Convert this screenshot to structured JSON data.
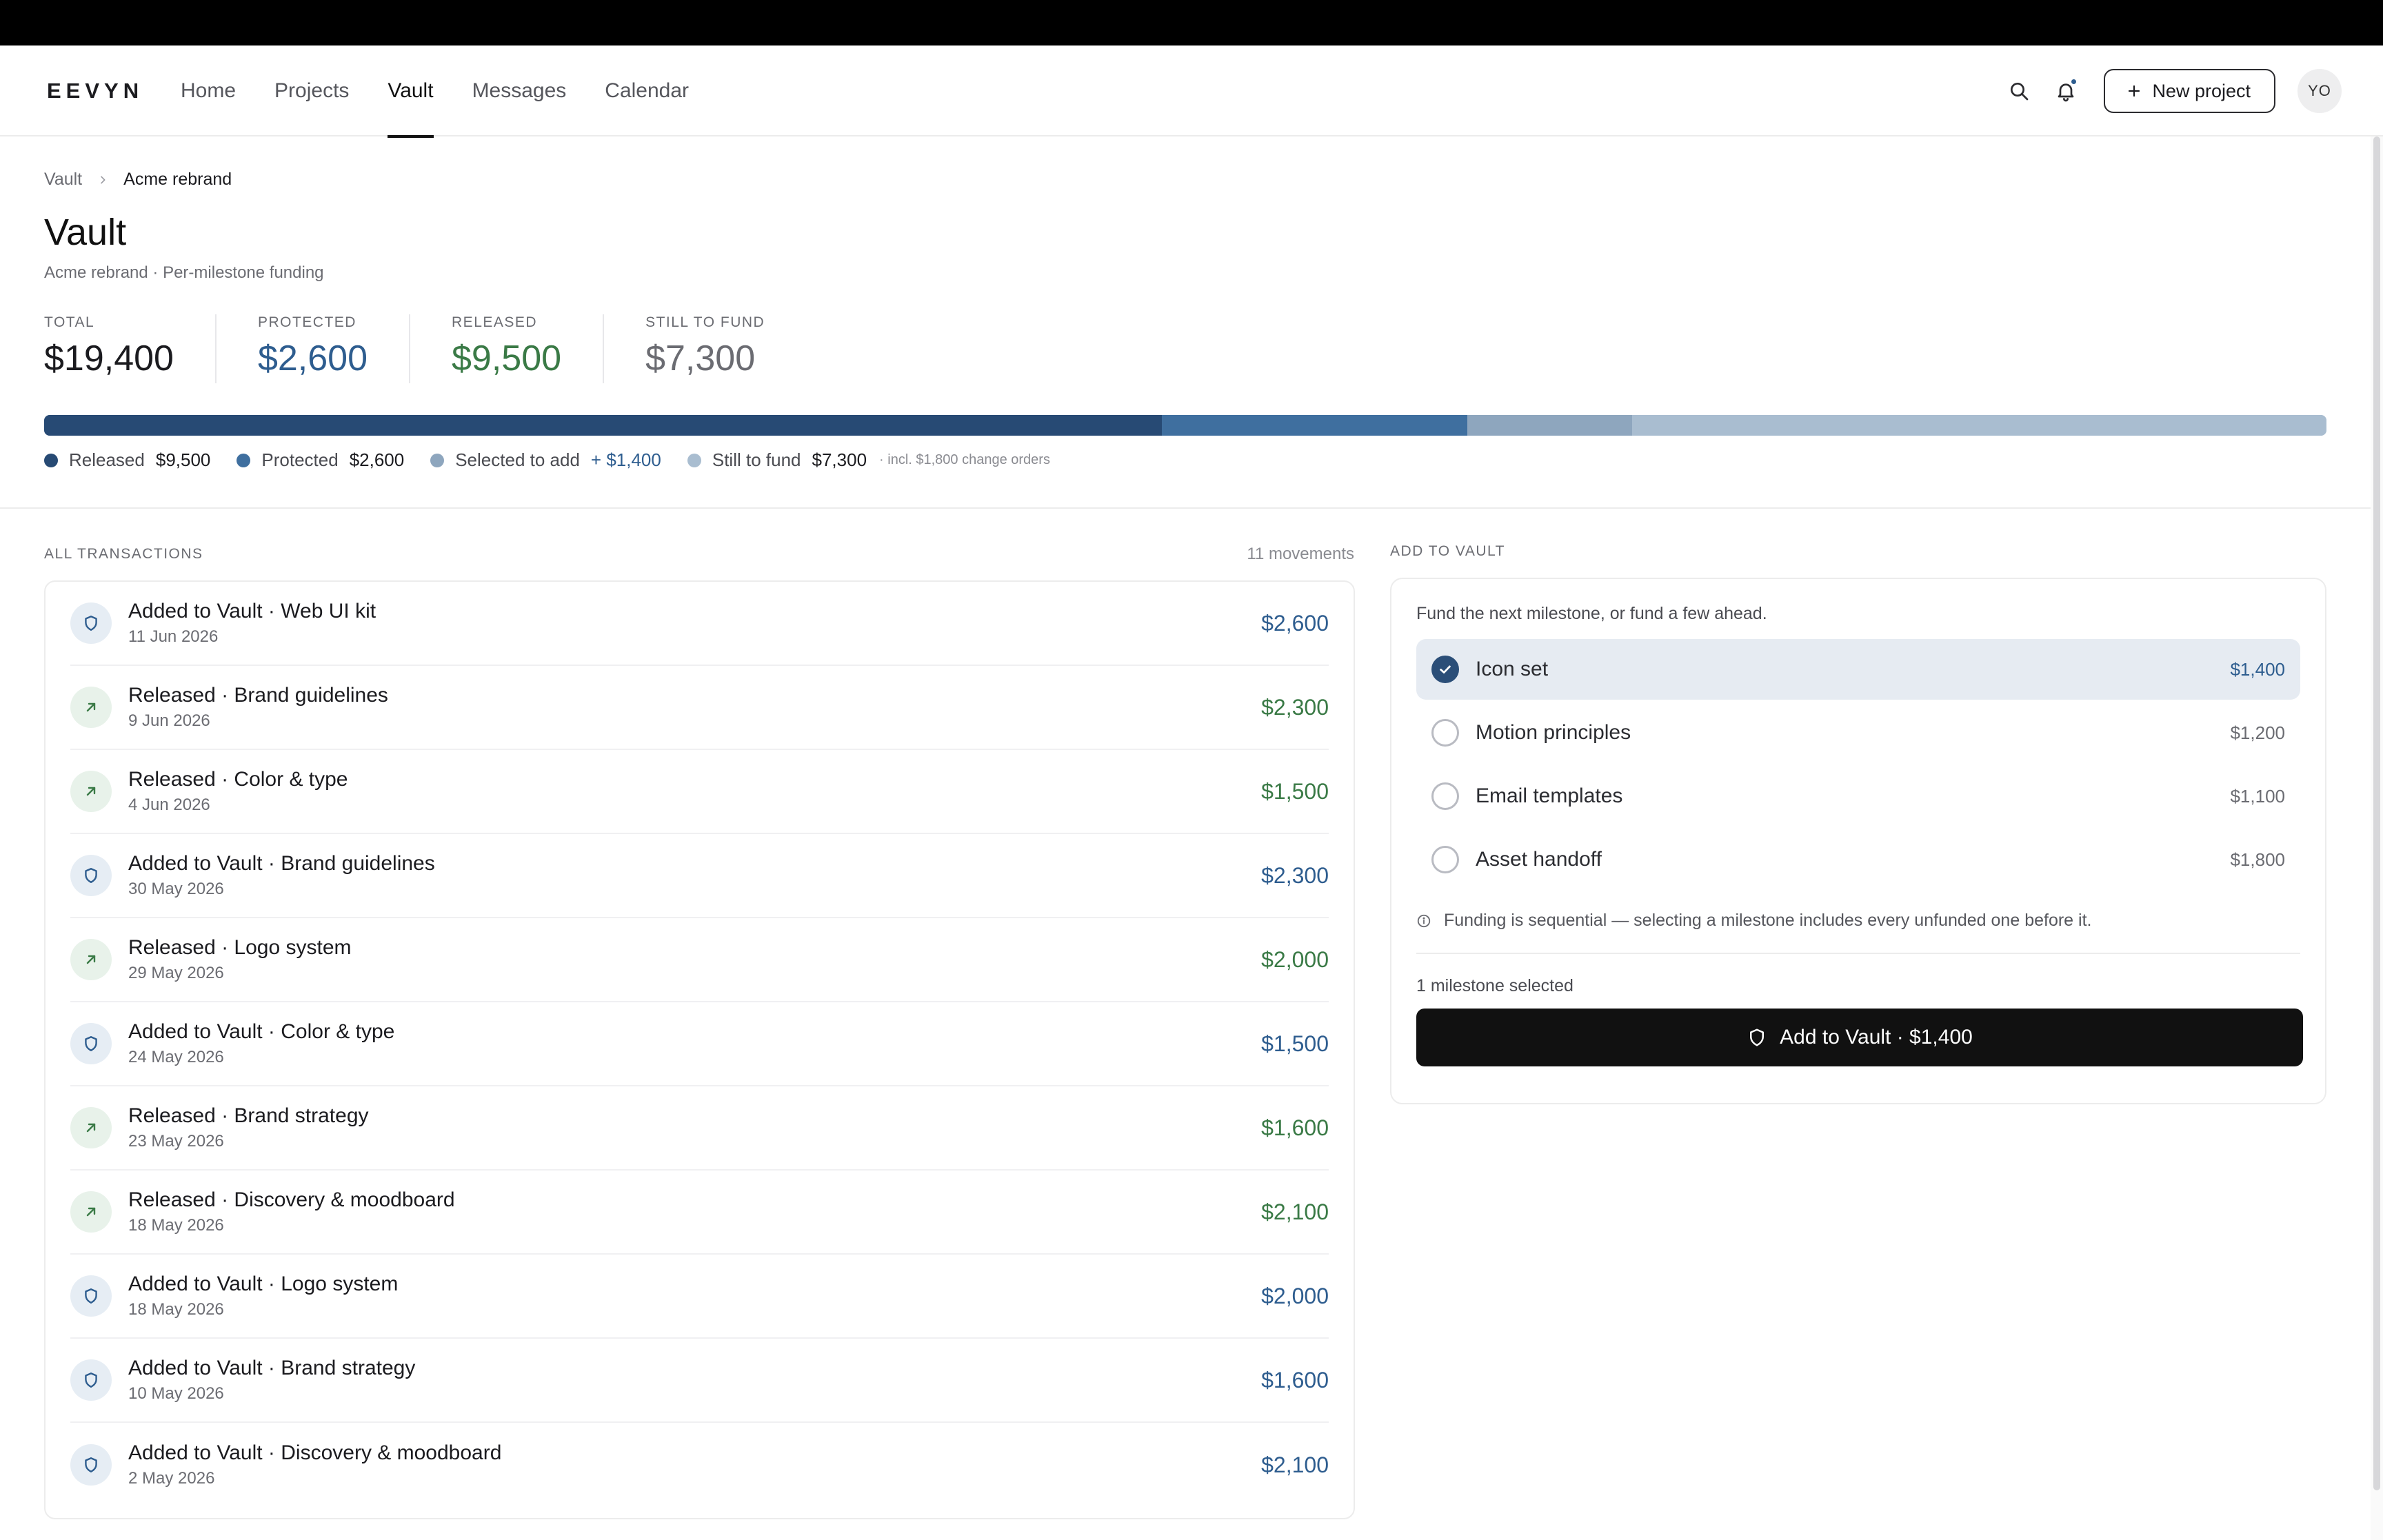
{
  "app": {
    "logo": "EEVYN",
    "nav": [
      "Home",
      "Projects",
      "Vault",
      "Messages",
      "Calendar"
    ],
    "active_nav": "Vault",
    "new_project_label": "New project",
    "avatar_initials": "YO"
  },
  "breadcrumb": {
    "parent": "Vault",
    "current": "Acme rebrand"
  },
  "page": {
    "title": "Vault",
    "subtitle": "Acme rebrand · Per-milestone funding"
  },
  "stats": [
    {
      "label": "TOTAL",
      "value": "$19,400",
      "color": "#1b1b1f"
    },
    {
      "label": "PROTECTED",
      "value": "$2,600",
      "color": "#2e5d8f"
    },
    {
      "label": "RELEASED",
      "value": "$9,500",
      "color": "#3a7a46"
    },
    {
      "label": "STILL TO FUND",
      "value": "$7,300",
      "color": "#6b6c72"
    }
  ],
  "funding_bar": {
    "total": 19400,
    "segments": [
      {
        "name": "Released",
        "amount": 9500,
        "color": "#274a74"
      },
      {
        "name": "Protected",
        "amount": 2600,
        "color": "#3f6f9f"
      },
      {
        "name": "Selected to add",
        "amount": 1400,
        "color": "#8ea6be"
      },
      {
        "name": "Still to fund",
        "amount": 5900,
        "color": "#a9bdd0"
      }
    ]
  },
  "legend": [
    {
      "label": "Released",
      "value": "$9,500",
      "color": "#274a74",
      "value_color": "#1b1b1f"
    },
    {
      "label": "Protected",
      "value": "$2,600",
      "color": "#3f6f9f",
      "value_color": "#1b1b1f"
    },
    {
      "label": "Selected to add",
      "value": "+ $1,400",
      "color": "#8ea6be",
      "value_color": "#2e5d8f"
    },
    {
      "label": "Still to fund",
      "value": "$7,300",
      "color": "#a9bdd0",
      "value_color": "#1b1b1f"
    }
  ],
  "legend_note": "· incl. $1,800 change orders",
  "transactions": {
    "heading": "ALL TRANSACTIONS",
    "count": "11 movements",
    "items": [
      {
        "type": "added",
        "title": "Added to Vault · Web UI kit",
        "date": "11 Jun 2026",
        "amount": "$2,600"
      },
      {
        "type": "released",
        "title": "Released · Brand guidelines",
        "date": "9 Jun 2026",
        "amount": "$2,300"
      },
      {
        "type": "released",
        "title": "Released · Color & type",
        "date": "4 Jun 2026",
        "amount": "$1,500"
      },
      {
        "type": "added",
        "title": "Added to Vault · Brand guidelines",
        "date": "30 May 2026",
        "amount": "$2,300"
      },
      {
        "type": "released",
        "title": "Released · Logo system",
        "date": "29 May 2026",
        "amount": "$2,000"
      },
      {
        "type": "added",
        "title": "Added to Vault · Color & type",
        "date": "24 May 2026",
        "amount": "$1,500"
      },
      {
        "type": "released",
        "title": "Released · Brand strategy",
        "date": "23 May 2026",
        "amount": "$1,600"
      },
      {
        "type": "released",
        "title": "Released · Discovery & moodboard",
        "date": "18 May 2026",
        "amount": "$2,100"
      },
      {
        "type": "added",
        "title": "Added to Vault · Logo system",
        "date": "18 May 2026",
        "amount": "$2,000"
      },
      {
        "type": "added",
        "title": "Added to Vault · Brand strategy",
        "date": "10 May 2026",
        "amount": "$1,600"
      },
      {
        "type": "added",
        "title": "Added to Vault · Discovery & moodboard",
        "date": "2 May 2026",
        "amount": "$2,100"
      }
    ]
  },
  "add_to_vault": {
    "heading": "ADD TO VAULT",
    "intro": "Fund the next milestone, or fund a few ahead.",
    "milestones": [
      {
        "name": "Icon set",
        "amount": "$1,400",
        "selected": true
      },
      {
        "name": "Motion principles",
        "amount": "$1,200",
        "selected": false
      },
      {
        "name": "Email templates",
        "amount": "$1,100",
        "selected": false
      },
      {
        "name": "Asset handoff",
        "amount": "$1,800",
        "selected": false
      }
    ],
    "note": "Funding is sequential — selecting a milestone includes every unfunded one before it.",
    "selected_count": "1 milestone selected",
    "cta_label": "Add to Vault · $1,400"
  },
  "icons": {
    "search": "search-icon",
    "notifications": "bell-icon",
    "plus": "plus-icon",
    "breadcrumb_separator": "chevron-right-icon",
    "added": "shield-icon",
    "released": "arrow-up-right-icon",
    "info": "info-icon",
    "check": "check-icon",
    "cta": "shield-icon"
  }
}
